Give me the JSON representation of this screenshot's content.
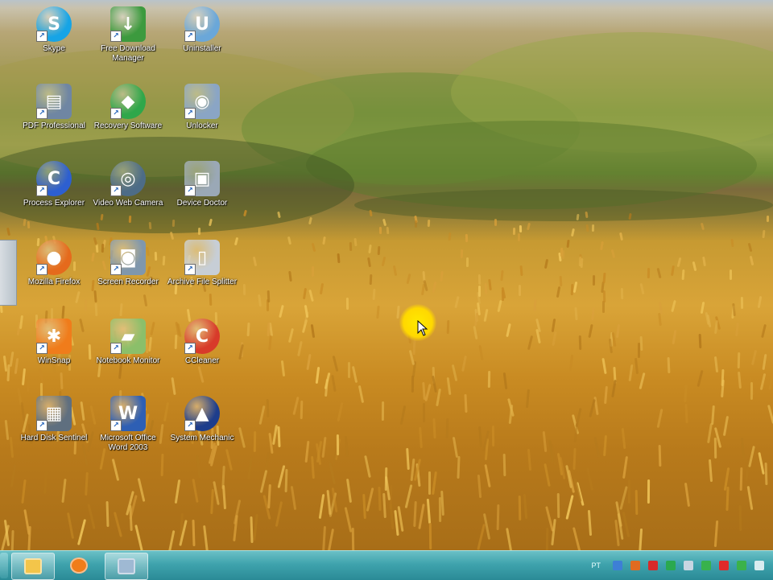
{
  "desktop": {
    "icons": [
      {
        "label": "Skype",
        "icon": "skype-icon",
        "color": "#16a4e6",
        "glyph": "S"
      },
      {
        "label": "Free Download Manager",
        "icon": "download-manager-icon",
        "color": "#3c9a3e",
        "glyph": "↓"
      },
      {
        "label": "Uninstaller",
        "icon": "uninstaller-icon",
        "color": "#6aa7d9",
        "glyph": "U"
      },
      {
        "label": "PDF Professional",
        "icon": "pdf-tool-icon",
        "color": "#6f86a3",
        "glyph": "▤"
      },
      {
        "label": "Recovery Software",
        "icon": "recovery-icon",
        "color": "#2fa74a",
        "glyph": "◆"
      },
      {
        "label": "Unlocker",
        "icon": "disc-tool-icon",
        "color": "#8aa5c5",
        "glyph": "◉"
      },
      {
        "label": "Process Explorer",
        "icon": "c-letter-icon",
        "color": "#2d5fd0",
        "glyph": "C"
      },
      {
        "label": "Video Web Camera",
        "icon": "webcam-icon",
        "color": "#4d6c87",
        "glyph": "◎"
      },
      {
        "label": "Device Doctor",
        "icon": "device-doctor-icon",
        "color": "#9aa8b6",
        "glyph": "▣"
      },
      {
        "label": "Mozilla Firefox",
        "icon": "firefox-icon",
        "color": "#e56a1c",
        "glyph": "●"
      },
      {
        "label": "Screen Recorder",
        "icon": "camera-icon",
        "color": "#7f97ad",
        "glyph": "◙"
      },
      {
        "label": "Archive File Splitter",
        "icon": "file-icon",
        "color": "#c7ced6",
        "glyph": "▯"
      },
      {
        "label": "WinSnap",
        "icon": "winsnap-icon",
        "color": "#f07c1b",
        "glyph": "✱"
      },
      {
        "label": "Notebook Monitor",
        "icon": "notebook-icon",
        "color": "#8bbf6a",
        "glyph": "▰"
      },
      {
        "label": "CCleaner",
        "icon": "ccleaner-icon",
        "color": "#d83a2a",
        "glyph": "C"
      },
      {
        "label": "Hard Disk Sentinel",
        "icon": "printer-icon",
        "color": "#5f6f7f",
        "glyph": "▦"
      },
      {
        "label": "Microsoft Office Word 2003",
        "icon": "word-icon",
        "color": "#2e5fb4",
        "glyph": "W"
      },
      {
        "label": "System Mechanic",
        "icon": "sailboat-icon",
        "color": "#1d3d8c",
        "glyph": "▲"
      }
    ]
  },
  "taskbar": {
    "pinned": [
      {
        "name": "file-explorer",
        "icon": "folder-icon",
        "color": "#f3c54a"
      },
      {
        "name": "media-player",
        "icon": "media-player-icon",
        "color": "#f07d1a"
      },
      {
        "name": "window",
        "icon": "window-icon",
        "color": "#9fb9d3"
      }
    ],
    "tray": {
      "language": "PT",
      "icons": [
        {
          "icon": "network-icon",
          "color": "#3d7fd6"
        },
        {
          "icon": "shield-icon",
          "color": "#e06b20"
        },
        {
          "icon": "alert-icon",
          "color": "#d82a2a"
        },
        {
          "icon": "sync-icon",
          "color": "#2aa94f"
        },
        {
          "icon": "chat-icon",
          "color": "#c8d6e2"
        },
        {
          "icon": "phone-icon",
          "color": "#38b24c"
        },
        {
          "icon": "antivirus-icon",
          "color": "#e02a2a"
        },
        {
          "icon": "monitor-icon",
          "color": "#3bb24a"
        },
        {
          "icon": "volume-icon",
          "color": "#d9ecf0"
        }
      ]
    }
  }
}
